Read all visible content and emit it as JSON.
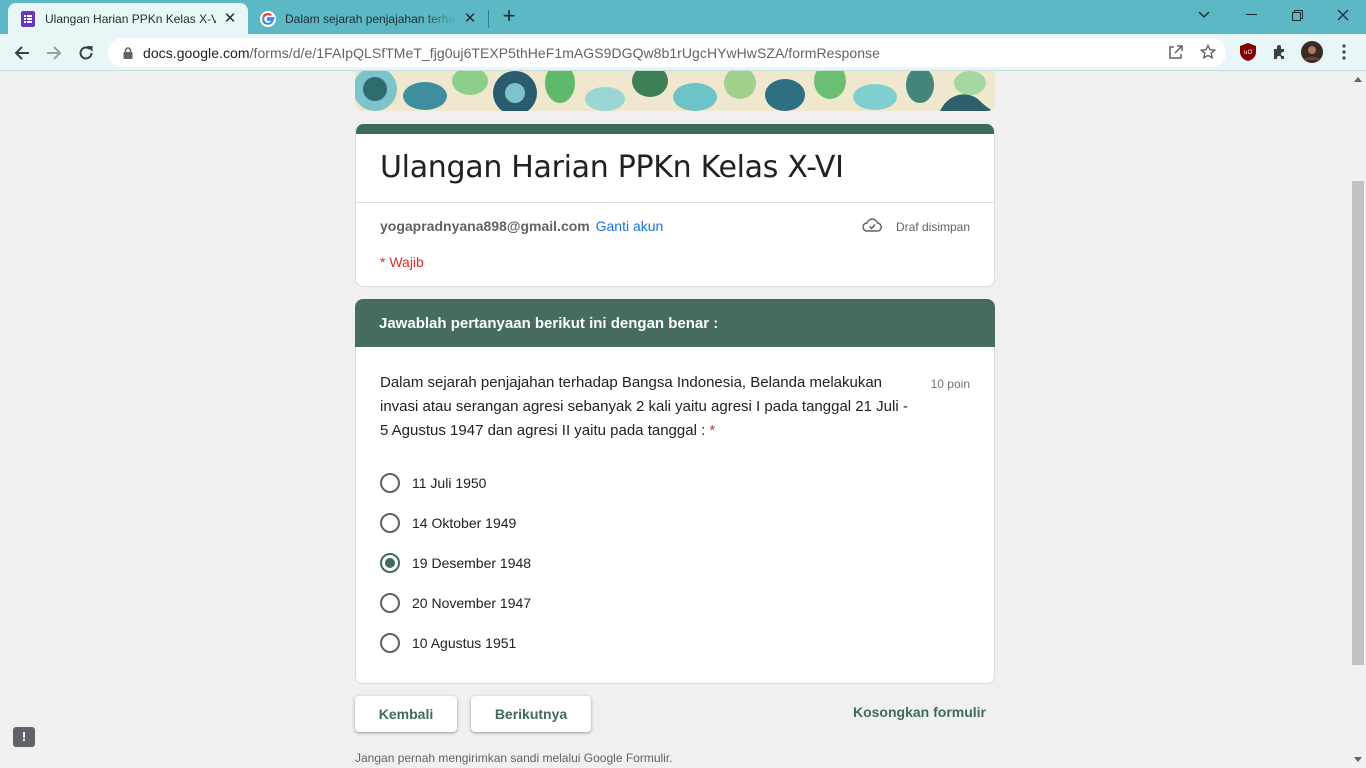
{
  "browser": {
    "tabs": [
      {
        "title": "Ulangan Harian PPKn Kelas X-VI",
        "icon": "google-forms-icon",
        "active": true
      },
      {
        "title": "Dalam sejarah penjajahan terhadap",
        "icon": "google-g-icon",
        "active": false
      }
    ],
    "url": {
      "host": "docs.google.com",
      "path": "/forms/d/e/1FAIpQLSfTMeT_fjg0uj6TEXP5thHeF1mAGS9DGQw8b1rUgcHYwHwSZA/formResponse"
    }
  },
  "form": {
    "title": "Ulangan Harian PPKn Kelas X-VI",
    "account_email": "yogapradnyana898@gmail.com",
    "switch_account": "Ganti akun",
    "draft_status": "Draf disimpan",
    "required_note": "* Wajib",
    "section_title": "Jawablah pertanyaan berikut ini dengan benar :",
    "question": {
      "text": "Dalam sejarah penjajahan terhadap Bangsa Indonesia, Belanda melakukan invasi atau serangan agresi sebanyak 2 kali yaitu agresi I pada tanggal 21 Juli - 5 Agustus 1947 dan agresi II yaitu pada tanggal :",
      "required_mark": "*",
      "points": "10 poin",
      "options": [
        {
          "label": "11 Juli 1950",
          "selected": false
        },
        {
          "label": "14 Oktober 1949",
          "selected": false
        },
        {
          "label": "19 Desember 1948",
          "selected": true
        },
        {
          "label": "20 November 1947",
          "selected": false
        },
        {
          "label": "10 Agustus 1951",
          "selected": false
        }
      ]
    },
    "buttons": {
      "back": "Kembali",
      "next": "Berikutnya",
      "clear": "Kosongkan formulir"
    },
    "footer_note": "Jangan pernah mengirimkan sandi melalui Google Formulir."
  },
  "colors": {
    "theme": "#3f6b5f",
    "section_header": "#466b60",
    "required": "#d93025",
    "link": "#1a73e8",
    "tabbar": "#5bb8c4"
  }
}
